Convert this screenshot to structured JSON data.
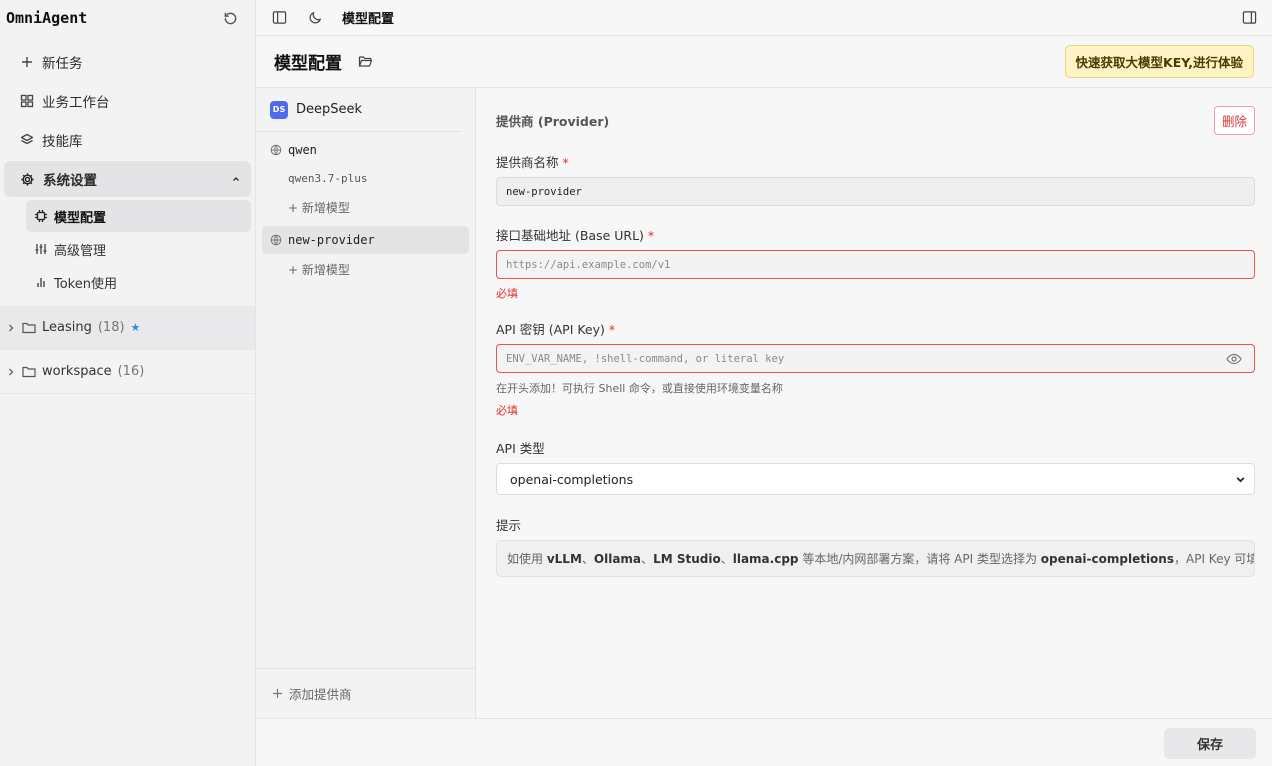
{
  "app": {
    "name": "OmniAgent"
  },
  "sidebar": {
    "nav": [
      {
        "label": "新任务",
        "icon": "plus-icon"
      },
      {
        "label": "业务工作台",
        "icon": "grid-icon"
      },
      {
        "label": "技能库",
        "icon": "layers-icon"
      }
    ],
    "settings": {
      "label": "系统设置",
      "icon": "gear-icon",
      "items": [
        {
          "label": "模型配置",
          "icon": "chip-icon",
          "active": true
        },
        {
          "label": "高级管理",
          "icon": "sliders-icon"
        },
        {
          "label": "Token使用",
          "icon": "bar-chart-icon"
        }
      ]
    },
    "workspaces": [
      {
        "name": "Leasing",
        "count": "(18)",
        "starred": true
      },
      {
        "name": "workspace",
        "count": "(16)"
      }
    ]
  },
  "topbar": {
    "title": "模型配置"
  },
  "page": {
    "title": "模型配置",
    "promo_button": "快速获取大模型KEY,进行体验"
  },
  "providers": {
    "top": {
      "badge": "DS",
      "name": "DeepSeek"
    },
    "list": [
      {
        "name": "qwen",
        "models": [
          "qwen3.7-plus"
        ],
        "add_model": "+ 新增模型"
      },
      {
        "name": "new-provider",
        "active": true,
        "models": [],
        "add_model": "+ 新增模型"
      }
    ],
    "add_provider": "添加提供商"
  },
  "form": {
    "section_title": "提供商 (Provider)",
    "delete_button": "删除",
    "name_label": "提供商名称",
    "name_value": "new-provider",
    "base_url_label": "接口基础地址 (Base URL)",
    "base_url_placeholder": "https://api.example.com/v1",
    "base_url_error": "必填",
    "api_key_label": "API 密钥 (API Key)",
    "api_key_placeholder": "ENV_VAR_NAME, !shell-command, or literal key",
    "api_key_help": "在开头添加！可执行 Shell 命令，或直接使用环境变量名称",
    "api_key_error": "必填",
    "api_type_label": "API 类型",
    "api_type_value": "openai-completions",
    "hint_label": "提示",
    "hint": {
      "p1": "如使用 ",
      "b1": "vLLM",
      "s1": "、",
      "b2": "Ollama",
      "s2": "、",
      "b3": "LM Studio",
      "s3": "、",
      "b4": "llama.cpp",
      "p2": " 等本地/内网部署方案，请将 API 类型选择为 ",
      "b5": "openai-completions",
      "p3": "，API Key 可填任意值。"
    },
    "required_mark": "*"
  },
  "footer": {
    "save_button": "保存"
  },
  "colors": {
    "accent_badge": "#4f6bed",
    "error": "#e03131",
    "promo_bg": "#fdf3c4"
  }
}
